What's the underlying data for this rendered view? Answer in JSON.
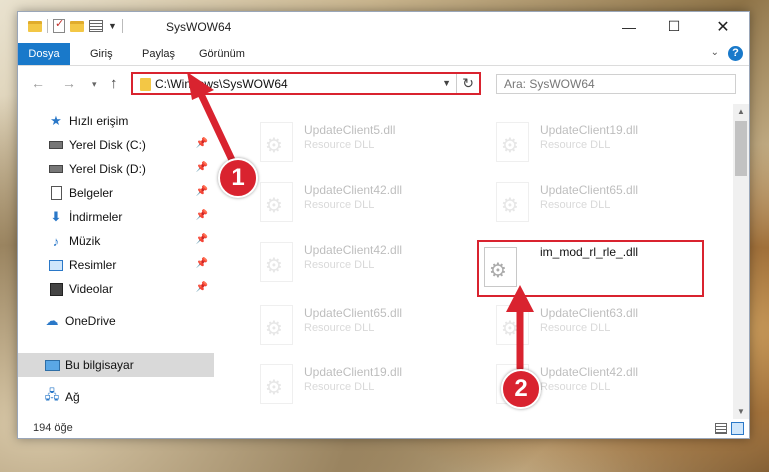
{
  "window": {
    "title": "SysWOW64",
    "controls": {
      "minimize": "—",
      "maximize": "☐",
      "close": "✕"
    }
  },
  "ribbon": {
    "tabs": [
      "Dosya",
      "Giriş",
      "Paylaş",
      "Görünüm"
    ],
    "help": "?"
  },
  "navigation": {
    "back": "←",
    "forward": "→",
    "recent": "▾",
    "up": "↑",
    "address": "C:\\Windows\\SysWOW64",
    "refresh": "↻",
    "search_placeholder": "Ara: SysWOW64"
  },
  "sidebar": {
    "quick_access": "Hızlı erişim",
    "items": [
      {
        "label": "Yerel Disk (C:)",
        "pinned": true
      },
      {
        "label": "Yerel Disk (D:)",
        "pinned": true
      },
      {
        "label": "Belgeler",
        "pinned": true
      },
      {
        "label": "İndirmeler",
        "pinned": true
      },
      {
        "label": "Müzik",
        "pinned": true
      },
      {
        "label": "Resimler",
        "pinned": true
      },
      {
        "label": "Videolar",
        "pinned": true
      }
    ],
    "onedrive": "OneDrive",
    "this_pc": "Bu bilgisayar",
    "network": "Ağ",
    "pin_glyph": "📌"
  },
  "files": [
    {
      "name": "UpdateClient5.dll",
      "type": "Resource DLL"
    },
    {
      "name": "UpdateClient19.dll",
      "type": "Resource DLL"
    },
    {
      "name": "UpdateClient42.dll",
      "type": "Resource DLL"
    },
    {
      "name": "UpdateClient65.dll",
      "type": "Resource DLL"
    },
    {
      "name": "UpdateClient42.dll",
      "type": "Resource DLL"
    },
    {
      "name": "im_mod_rl_rle_.dll",
      "type": ""
    },
    {
      "name": "UpdateClient65.dll",
      "type": "Resource DLL"
    },
    {
      "name": "UpdateClient63.dll",
      "type": "Resource DLL"
    },
    {
      "name": "UpdateClient19.dll",
      "type": "Resource DLL"
    },
    {
      "name": "UpdateClient42.dll",
      "type": "Resource DLL"
    }
  ],
  "status": {
    "count": "194 öğe"
  },
  "annotations": {
    "callout1": "1",
    "callout2": "2",
    "accent": "#d9232f"
  }
}
